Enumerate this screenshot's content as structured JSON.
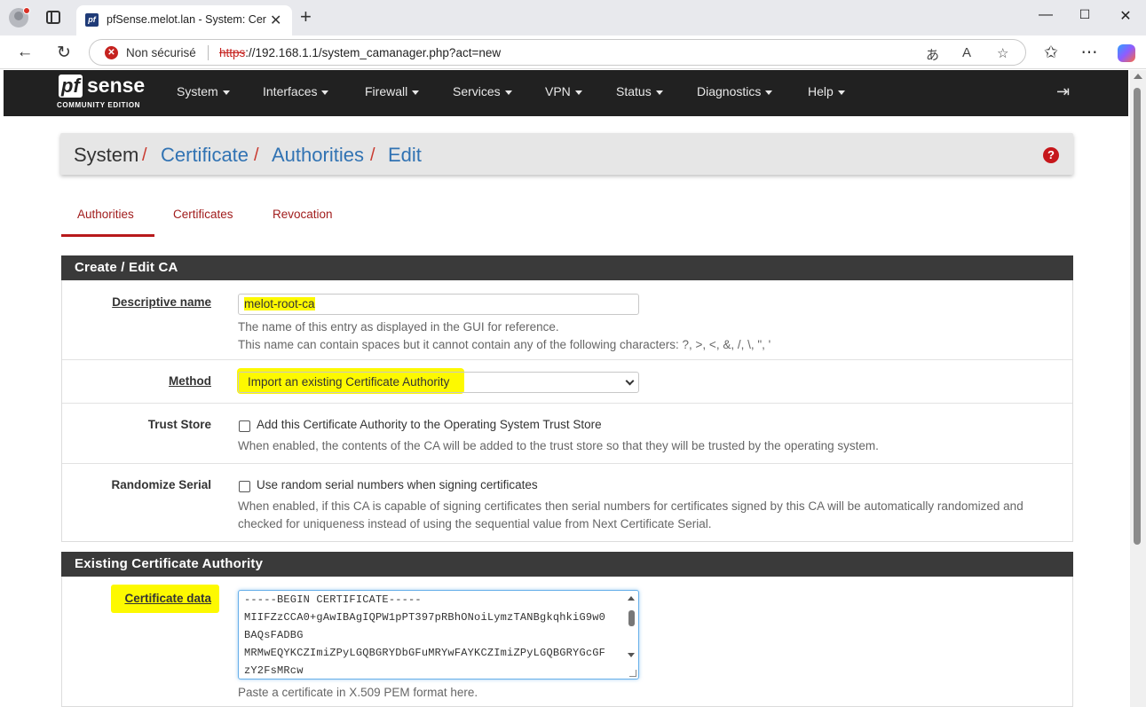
{
  "browser": {
    "tab_title": "pfSense.melot.lan - System: Certif",
    "tab_favicon_text": "pf",
    "security_label": "Non sécurisé",
    "url_scheme": "https",
    "url_rest": "://192.168.1.1/system_camanager.php?act=new"
  },
  "nav": {
    "logo_pf": "pf",
    "logo_sense": "sense",
    "logo_edition": "COMMUNITY EDITION",
    "menu": [
      "System",
      "Interfaces",
      "Firewall",
      "Services",
      "VPN",
      "Status",
      "Diagnostics",
      "Help"
    ]
  },
  "breadcrumb": {
    "items": [
      "System",
      "Certificate",
      "Authorities",
      "Edit"
    ],
    "separator": "/"
  },
  "tabs": [
    "Authorities",
    "Certificates",
    "Revocation"
  ],
  "section1": {
    "title": "Create / Edit CA",
    "descriptive_name": {
      "label": "Descriptive name",
      "value": "melot-root-ca",
      "help1": "The name of this entry as displayed in the GUI for reference.",
      "help2": "This name can contain spaces but it cannot contain any of the following characters: ?, >, <, &, /, \\, \", '"
    },
    "method": {
      "label": "Method",
      "value": "Import an existing Certificate Authority"
    },
    "trust_store": {
      "label": "Trust Store",
      "checkbox_label": "Add this Certificate Authority to the Operating System Trust Store",
      "help": "When enabled, the contents of the CA will be added to the trust store so that they will be trusted by the operating system."
    },
    "randomize_serial": {
      "label": "Randomize Serial",
      "checkbox_label": "Use random serial numbers when signing certificates",
      "help1": "When enabled, if this CA is capable of signing certificates then serial numbers for certificates signed by this CA will be automatically randomized and",
      "help2": "checked for uniqueness instead of using the sequential value from Next Certificate Serial."
    }
  },
  "section2": {
    "title": "Existing Certificate Authority",
    "certificate_data": {
      "label": "Certificate data",
      "lines": [
        "-----BEGIN CERTIFICATE-----",
        "MIIFZzCCA0+gAwIBAgIQPW1pPT397pRBhONoiLymzTANBgkqhkiG9w0",
        "BAQsFADBG",
        "MRMwEQYKCZImiZPyLGQBGRYDbGFuMRYwFAYKCZImiZPyLGQBGRYGcGF",
        "zY2FsMRcw"
      ],
      "help": "Paste a certificate in X.509 PEM format here."
    }
  },
  "colors": {
    "highlight": "#fdf900",
    "nav_bg": "#212121",
    "link": "#3173b3",
    "accent_red": "#b8191b"
  }
}
